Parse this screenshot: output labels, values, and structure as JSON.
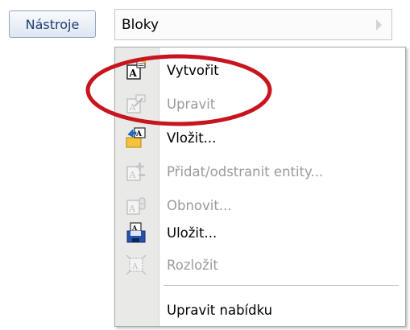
{
  "toolbar": {
    "tools_label": "Nástroje"
  },
  "submenu": {
    "title": "Bloky"
  },
  "menu": {
    "items": [
      {
        "label": "Vytvořit",
        "enabled": true,
        "icon": "create-block-icon"
      },
      {
        "label": "Upravit",
        "enabled": false,
        "icon": "edit-block-icon"
      },
      {
        "label": "Vložit...",
        "enabled": true,
        "icon": "insert-block-icon"
      },
      {
        "label": "Přidat/odstranit entity...",
        "enabled": false,
        "icon": "add-remove-entities-icon"
      },
      {
        "label": "Obnovit...",
        "enabled": false,
        "icon": "refresh-block-icon"
      },
      {
        "label": "Uložit...",
        "enabled": true,
        "icon": "save-block-icon"
      },
      {
        "label": "Rozložit",
        "enabled": false,
        "icon": "explode-block-icon"
      }
    ],
    "customize_label": "Upravit nabídku"
  },
  "colors": {
    "highlight": "#c8141e",
    "disabled_text": "#9a9a9a",
    "button_text": "#1f3c78"
  }
}
